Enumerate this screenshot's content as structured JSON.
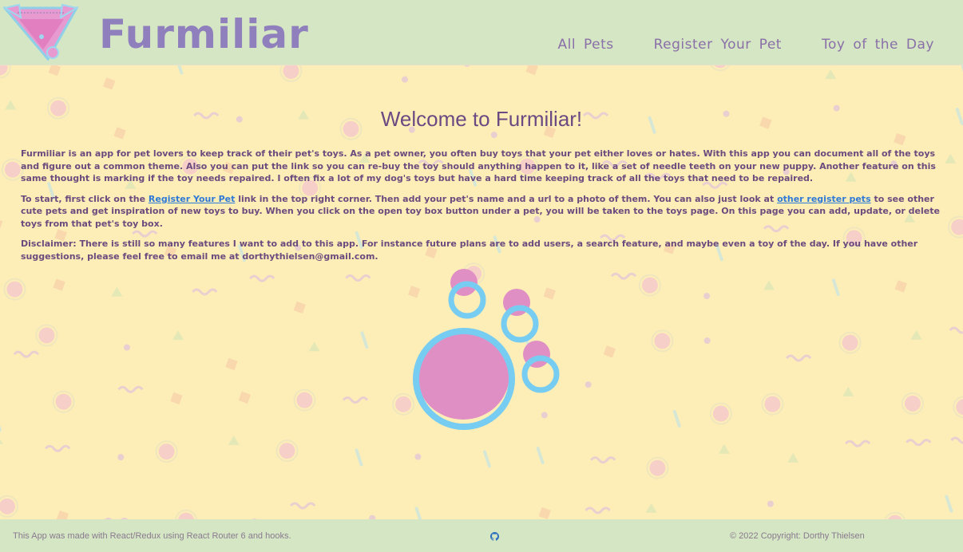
{
  "header": {
    "brand": "Furmiliar",
    "nav": {
      "all_pets": "All Pets",
      "register": "Register Your Pet",
      "toy_of_day": "Toy of the Day"
    }
  },
  "main": {
    "title": "Welcome to Furmiliar!",
    "para1": "Furmiliar is an app for pet lovers to keep track of their pet's toys. As a pet owner, you often buy toys that your pet either loves or hates. With this app you can document all of the toys and figure out a common theme. Also you can put the link so you can re-buy the toy should anything happen to it, like a set of needle teeth on your new puppy. Another feature on this same thought is marking if the toy needs repaired. I often fix a lot of my dog's toys but have a hard time keeping track of all the toys that need to be repaired.",
    "para2_a": "To start, first click on the ",
    "para2_link1": "Register Your Pet",
    "para2_b": " link in the top right corner. Then add your pet's name and a url to a photo of them. You can also just look at ",
    "para2_link2": "other register pets",
    "para2_c": " to see other cute pets and get inspiration of new toys to buy. When you click on the open toy box button under a pet, you will be taken to the toys page. On this page you can add, update, or delete toys from that pet's toy box.",
    "para3": "Disclaimer: There is still so many features I want to add to this app. For instance future plans are to add users, a search feature, and maybe even a toy of the day. If you have other suggestions, please feel free to email me at dorthythielsen@gmail.com."
  },
  "footer": {
    "left": "This App was made with React/Redux using React Router 6 and hooks.",
    "right": "© 2022 Copyright: Dorthy Thielsen"
  },
  "colors": {
    "header_bg": "#d4e6c3",
    "page_bg": "#fdeeb7",
    "brand": "#8f7fbd",
    "pink": "#e08fc4",
    "blue": "#77ccf2",
    "link": "#2f7ad6"
  },
  "icons": [
    "logo-icon",
    "paw-print-icon",
    "github-icon"
  ]
}
